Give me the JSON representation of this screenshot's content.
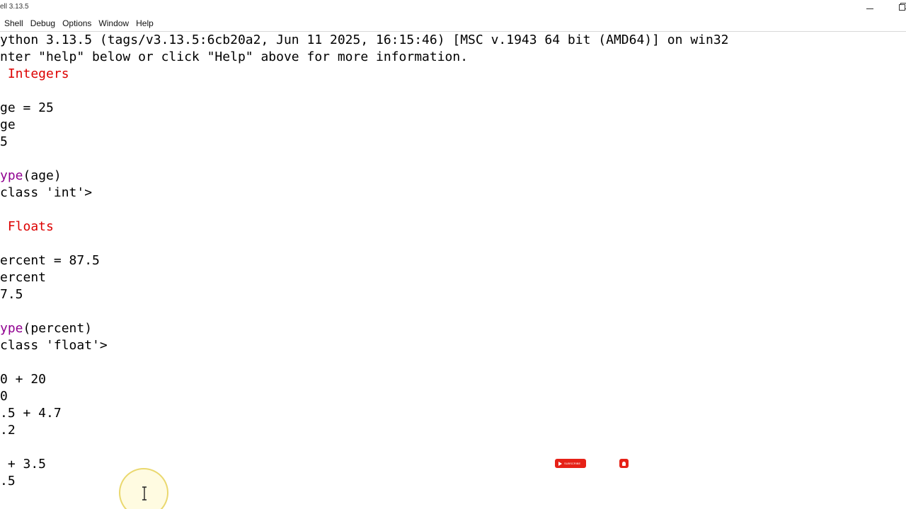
{
  "window": {
    "title": "ell 3.13.5"
  },
  "menu": {
    "items": [
      "Shell",
      "Debug",
      "Options",
      "Window",
      "Help"
    ]
  },
  "shell": {
    "lines": [
      {
        "text": "ython 3.13.5 (tags/v3.13.5:6cb20a2, Jun 11 2025, 16:15:46) [MSC v.1943 64 bit (AMD64)] on win32",
        "kind": "banner"
      },
      {
        "text": "nter \"help\" below or click \"Help\" above for more information.",
        "kind": "banner"
      },
      {
        "text": " Integers",
        "kind": "comment"
      },
      {
        "text": "",
        "kind": "blank"
      },
      {
        "text": "ge = 25",
        "kind": "input"
      },
      {
        "text": "ge",
        "kind": "input"
      },
      {
        "text": "5",
        "kind": "output"
      },
      {
        "text": "",
        "kind": "blank"
      },
      {
        "text": "ype(age)",
        "kind": "builtin-call",
        "builtin": "ype",
        "rest": "(age)"
      },
      {
        "text": "class 'int'>",
        "kind": "output"
      },
      {
        "text": "",
        "kind": "blank"
      },
      {
        "text": " Floats",
        "kind": "comment"
      },
      {
        "text": "",
        "kind": "blank"
      },
      {
        "text": "ercent = 87.5",
        "kind": "input"
      },
      {
        "text": "ercent",
        "kind": "input"
      },
      {
        "text": "7.5",
        "kind": "output"
      },
      {
        "text": "",
        "kind": "blank"
      },
      {
        "text": "ype(percent)",
        "kind": "builtin-call",
        "builtin": "ype",
        "rest": "(percent)"
      },
      {
        "text": "class 'float'>",
        "kind": "output"
      },
      {
        "text": "",
        "kind": "blank"
      },
      {
        "text": "0 + 20",
        "kind": "input"
      },
      {
        "text": "0",
        "kind": "output"
      },
      {
        "text": ".5 + 4.7",
        "kind": "input"
      },
      {
        "text": ".2",
        "kind": "output"
      },
      {
        "text": "",
        "kind": "blank"
      },
      {
        "text": " + 3.5",
        "kind": "input"
      },
      {
        "text": ".5",
        "kind": "output"
      }
    ]
  },
  "overlay": {
    "subscribe_label": "SUBSCRIBE",
    "icons": [
      "youtube-play-icon",
      "bell-icon"
    ]
  },
  "colors": {
    "comment": "#dd0000",
    "builtin": "#900090",
    "output": "#0000ff",
    "default": "#000000"
  }
}
